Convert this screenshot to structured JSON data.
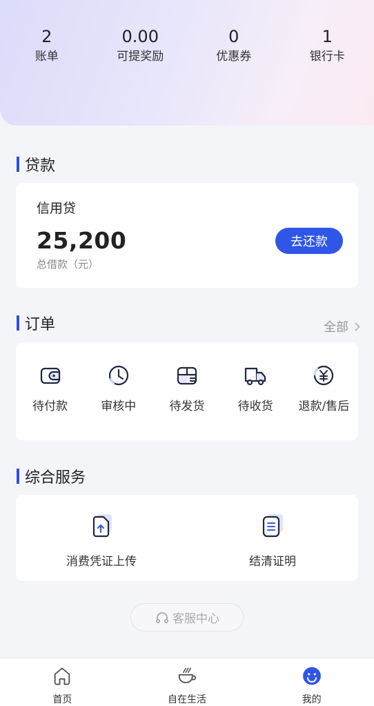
{
  "stats": [
    {
      "value": "2",
      "label": "账单"
    },
    {
      "value": "0.00",
      "label": "可提奖励"
    },
    {
      "value": "0",
      "label": "优惠券"
    },
    {
      "value": "1",
      "label": "银行卡"
    }
  ],
  "loan": {
    "section_title": "贷款",
    "product_name": "信用贷",
    "amount": "25,200",
    "amount_label": "总借款（元）",
    "repay_button": "去还款"
  },
  "orders": {
    "section_title": "订单",
    "view_all": "全部",
    "items": [
      {
        "label": "待付款",
        "icon": "wallet-icon"
      },
      {
        "label": "审核中",
        "icon": "clock-icon"
      },
      {
        "label": "待发货",
        "icon": "package-icon"
      },
      {
        "label": "待收货",
        "icon": "truck-icon"
      },
      {
        "label": "退款/售后",
        "icon": "refund-icon"
      }
    ]
  },
  "services": {
    "section_title": "综合服务",
    "items": [
      {
        "label": "消费凭证上传",
        "icon": "upload-document-icon"
      },
      {
        "label": "结清证明",
        "icon": "certificate-document-icon"
      }
    ]
  },
  "support": {
    "label": "客服中心",
    "icon": "headset-icon"
  },
  "tabbar": [
    {
      "label": "首页",
      "icon": "home-icon",
      "active": false
    },
    {
      "label": "自在生活",
      "icon": "coffee-cup-icon",
      "active": false
    },
    {
      "label": "我的",
      "icon": "smiley-icon",
      "active": true
    }
  ],
  "colors": {
    "accent": "#2f56e6",
    "section_bar": "#2f4fe0",
    "icon_stroke": "#1f2640"
  }
}
